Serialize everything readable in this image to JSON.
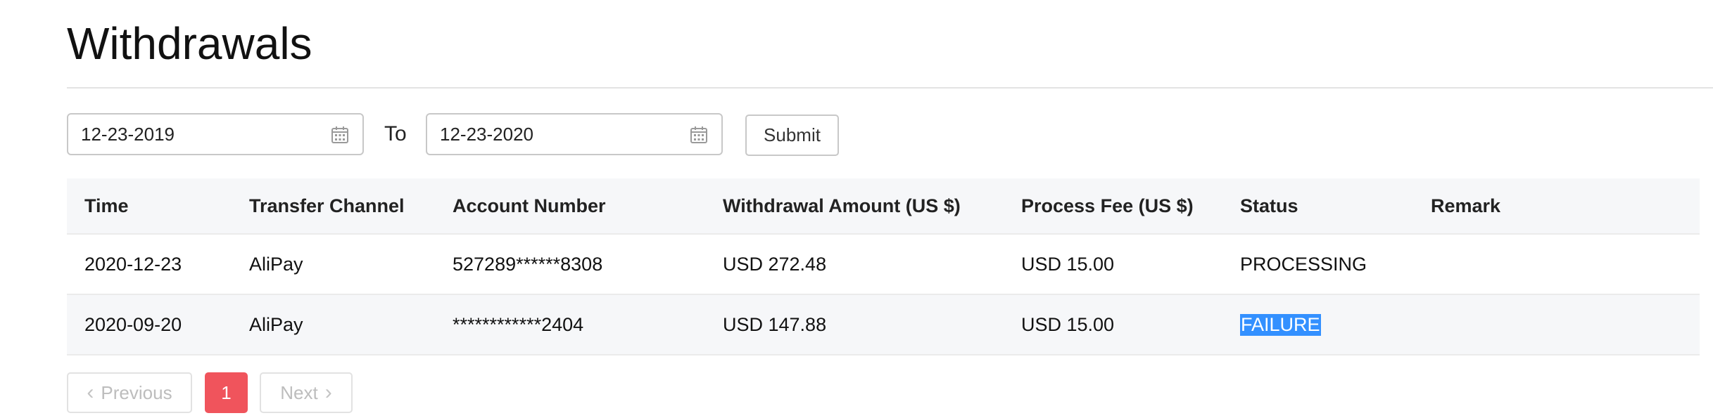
{
  "page": {
    "title": "Withdrawals"
  },
  "filter": {
    "from_date": "12-23-2019",
    "to_label": "To",
    "to_date": "12-23-2020",
    "submit_label": "Submit",
    "calendar_icon": "calendar-icon"
  },
  "table": {
    "columns": [
      "Time",
      "Transfer Channel",
      "Account Number",
      "Withdrawal Amount (US $)",
      "Process Fee (US $)",
      "Status",
      "Remark"
    ],
    "rows": [
      [
        "2020-12-23",
        "AliPay",
        "527289******8308",
        "USD 272.48",
        "USD 15.00",
        "PROCESSING",
        ""
      ],
      [
        "2020-09-20",
        "AliPay",
        "************2404",
        "USD 147.88",
        "USD 15.00",
        "FAILURE",
        ""
      ]
    ]
  },
  "pagination": {
    "previous_label": "Previous",
    "current_page": "1",
    "next_label": "Next",
    "previous_icon": "chevron-left-icon",
    "next_icon": "chevron-right-icon"
  },
  "colors": {
    "active_page": "#f0545c",
    "selection": "#3390ff",
    "header_bg": "#f6f7f9"
  }
}
